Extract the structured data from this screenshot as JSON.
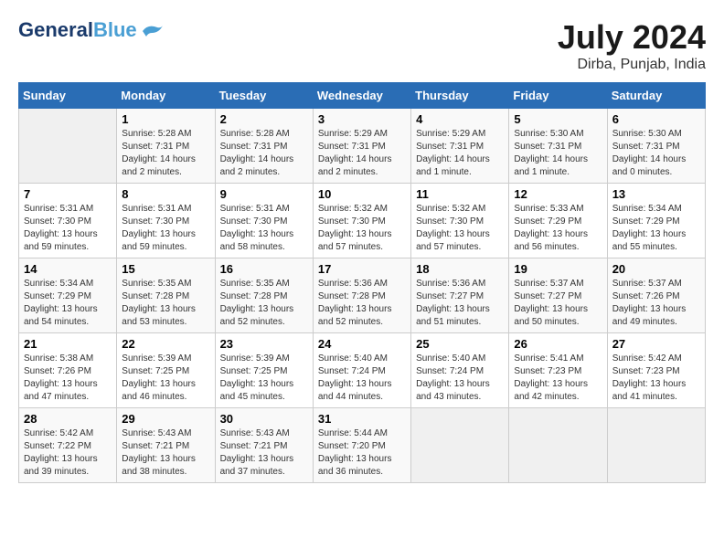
{
  "header": {
    "logo_line1": "General",
    "logo_line2": "Blue",
    "month_year": "July 2024",
    "location": "Dirba, Punjab, India"
  },
  "days_of_week": [
    "Sunday",
    "Monday",
    "Tuesday",
    "Wednesday",
    "Thursday",
    "Friday",
    "Saturday"
  ],
  "weeks": [
    [
      {
        "day": "",
        "sunrise": "",
        "sunset": "",
        "daylight": ""
      },
      {
        "day": "1",
        "sunrise": "5:28 AM",
        "sunset": "7:31 PM",
        "daylight": "14 hours and 2 minutes."
      },
      {
        "day": "2",
        "sunrise": "5:28 AM",
        "sunset": "7:31 PM",
        "daylight": "14 hours and 2 minutes."
      },
      {
        "day": "3",
        "sunrise": "5:29 AM",
        "sunset": "7:31 PM",
        "daylight": "14 hours and 2 minutes."
      },
      {
        "day": "4",
        "sunrise": "5:29 AM",
        "sunset": "7:31 PM",
        "daylight": "14 hours and 1 minute."
      },
      {
        "day": "5",
        "sunrise": "5:30 AM",
        "sunset": "7:31 PM",
        "daylight": "14 hours and 1 minute."
      },
      {
        "day": "6",
        "sunrise": "5:30 AM",
        "sunset": "7:31 PM",
        "daylight": "14 hours and 0 minutes."
      }
    ],
    [
      {
        "day": "7",
        "sunrise": "5:31 AM",
        "sunset": "7:30 PM",
        "daylight": "13 hours and 59 minutes."
      },
      {
        "day": "8",
        "sunrise": "5:31 AM",
        "sunset": "7:30 PM",
        "daylight": "13 hours and 59 minutes."
      },
      {
        "day": "9",
        "sunrise": "5:31 AM",
        "sunset": "7:30 PM",
        "daylight": "13 hours and 58 minutes."
      },
      {
        "day": "10",
        "sunrise": "5:32 AM",
        "sunset": "7:30 PM",
        "daylight": "13 hours and 57 minutes."
      },
      {
        "day": "11",
        "sunrise": "5:32 AM",
        "sunset": "7:30 PM",
        "daylight": "13 hours and 57 minutes."
      },
      {
        "day": "12",
        "sunrise": "5:33 AM",
        "sunset": "7:29 PM",
        "daylight": "13 hours and 56 minutes."
      },
      {
        "day": "13",
        "sunrise": "5:34 AM",
        "sunset": "7:29 PM",
        "daylight": "13 hours and 55 minutes."
      }
    ],
    [
      {
        "day": "14",
        "sunrise": "5:34 AM",
        "sunset": "7:29 PM",
        "daylight": "13 hours and 54 minutes."
      },
      {
        "day": "15",
        "sunrise": "5:35 AM",
        "sunset": "7:28 PM",
        "daylight": "13 hours and 53 minutes."
      },
      {
        "day": "16",
        "sunrise": "5:35 AM",
        "sunset": "7:28 PM",
        "daylight": "13 hours and 52 minutes."
      },
      {
        "day": "17",
        "sunrise": "5:36 AM",
        "sunset": "7:28 PM",
        "daylight": "13 hours and 52 minutes."
      },
      {
        "day": "18",
        "sunrise": "5:36 AM",
        "sunset": "7:27 PM",
        "daylight": "13 hours and 51 minutes."
      },
      {
        "day": "19",
        "sunrise": "5:37 AM",
        "sunset": "7:27 PM",
        "daylight": "13 hours and 50 minutes."
      },
      {
        "day": "20",
        "sunrise": "5:37 AM",
        "sunset": "7:26 PM",
        "daylight": "13 hours and 49 minutes."
      }
    ],
    [
      {
        "day": "21",
        "sunrise": "5:38 AM",
        "sunset": "7:26 PM",
        "daylight": "13 hours and 47 minutes."
      },
      {
        "day": "22",
        "sunrise": "5:39 AM",
        "sunset": "7:25 PM",
        "daylight": "13 hours and 46 minutes."
      },
      {
        "day": "23",
        "sunrise": "5:39 AM",
        "sunset": "7:25 PM",
        "daylight": "13 hours and 45 minutes."
      },
      {
        "day": "24",
        "sunrise": "5:40 AM",
        "sunset": "7:24 PM",
        "daylight": "13 hours and 44 minutes."
      },
      {
        "day": "25",
        "sunrise": "5:40 AM",
        "sunset": "7:24 PM",
        "daylight": "13 hours and 43 minutes."
      },
      {
        "day": "26",
        "sunrise": "5:41 AM",
        "sunset": "7:23 PM",
        "daylight": "13 hours and 42 minutes."
      },
      {
        "day": "27",
        "sunrise": "5:42 AM",
        "sunset": "7:23 PM",
        "daylight": "13 hours and 41 minutes."
      }
    ],
    [
      {
        "day": "28",
        "sunrise": "5:42 AM",
        "sunset": "7:22 PM",
        "daylight": "13 hours and 39 minutes."
      },
      {
        "day": "29",
        "sunrise": "5:43 AM",
        "sunset": "7:21 PM",
        "daylight": "13 hours and 38 minutes."
      },
      {
        "day": "30",
        "sunrise": "5:43 AM",
        "sunset": "7:21 PM",
        "daylight": "13 hours and 37 minutes."
      },
      {
        "day": "31",
        "sunrise": "5:44 AM",
        "sunset": "7:20 PM",
        "daylight": "13 hours and 36 minutes."
      },
      {
        "day": "",
        "sunrise": "",
        "sunset": "",
        "daylight": ""
      },
      {
        "day": "",
        "sunrise": "",
        "sunset": "",
        "daylight": ""
      },
      {
        "day": "",
        "sunrise": "",
        "sunset": "",
        "daylight": ""
      }
    ]
  ],
  "labels": {
    "sunrise_prefix": "Sunrise: ",
    "sunset_prefix": "Sunset: ",
    "daylight_prefix": "Daylight: "
  }
}
